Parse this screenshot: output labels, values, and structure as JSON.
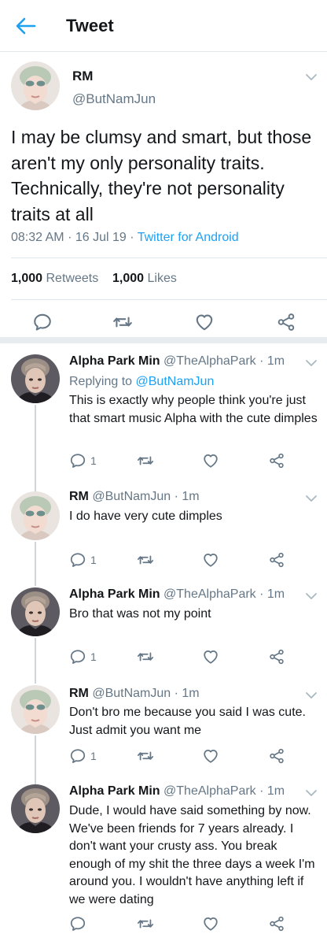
{
  "header": {
    "title": "Tweet",
    "back_icon": "arrow-left-icon",
    "accent": "#1da1f2"
  },
  "main_tweet": {
    "name": "RM",
    "handle": "@ButNamJun",
    "text": "I may be clumsy and smart, but those aren't my only personality traits. Technically, they're not personality traits at all",
    "time": "08:32 AM",
    "date": "16 Jul 19",
    "source": "Twitter for Android",
    "retweets_count": "1,000",
    "retweets_label": "Retweets",
    "likes_count": "1,000",
    "likes_label": "Likes"
  },
  "replies": [
    {
      "name": "Alpha Park Min",
      "handle": "@TheAlphaPark",
      "time": "1m",
      "replying_prefix": "Replying to",
      "replying_to": "@ButNamJun",
      "text": "This is exactly why people think you're just that smart music Alpha with the cute dimples",
      "reply_count": "1"
    },
    {
      "name": "RM",
      "handle": "@ButNamJun",
      "time": "1m",
      "text": "I do have very cute dimples",
      "reply_count": "1"
    },
    {
      "name": "Alpha Park Min",
      "handle": "@TheAlphaPark",
      "time": "1m",
      "text": "Bro that was not my point",
      "reply_count": "1"
    },
    {
      "name": "RM",
      "handle": "@ButNamJun",
      "time": "1m",
      "text": "Don't bro me because you said I was cute. Just admit you want me",
      "reply_count": "1"
    },
    {
      "name": "Alpha Park Min",
      "handle": "@TheAlphaPark",
      "time": "1m",
      "text": "Dude, I would have said something by now. We've been friends for 7 years already. I don't want your crusty ass. You break enough of my shit the three days a week I'm around you. I wouldn't have anything left if we were dating",
      "reply_count": ""
    }
  ]
}
